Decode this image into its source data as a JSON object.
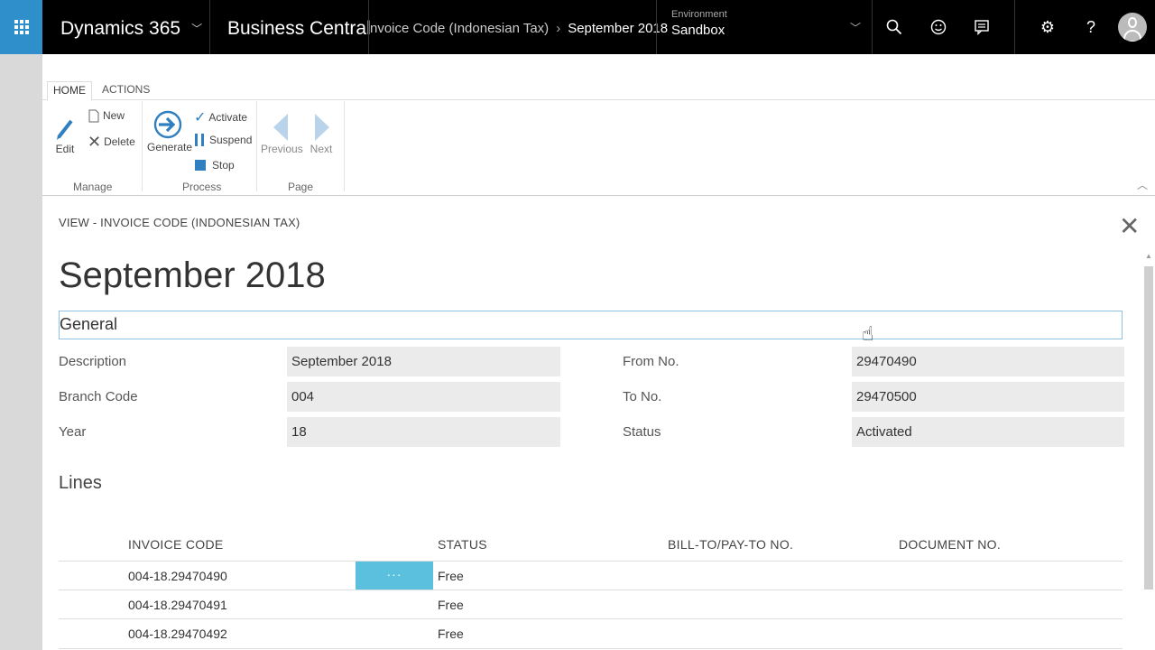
{
  "topbar": {
    "product": "Dynamics 365",
    "app": "Business Central",
    "breadcrumb_parent": "nvoice Code (Indonesian Tax)",
    "breadcrumb_current": "September 2018",
    "env_label": "Environment",
    "env_value": "Sandbox"
  },
  "ribbon": {
    "tabs": [
      "HOME",
      "ACTIONS"
    ],
    "manage": {
      "edit": "Edit",
      "new": "New",
      "delete": "Delete",
      "label": "Manage"
    },
    "process": {
      "generate": "Generate",
      "activate": "Activate",
      "suspend": "Suspend",
      "stop": "Stop",
      "label": "Process"
    },
    "page": {
      "previous": "Previous",
      "next": "Next",
      "label": "Page"
    }
  },
  "page": {
    "view_title": "VIEW - INVOICE CODE (INDONESIAN TAX)",
    "title": "September 2018",
    "general_label": "General",
    "fields_left": [
      {
        "label": "Description",
        "value": "September 2018"
      },
      {
        "label": "Branch Code",
        "value": "004"
      },
      {
        "label": "Year",
        "value": "18"
      }
    ],
    "fields_right": [
      {
        "label": "From No.",
        "value": "29470490"
      },
      {
        "label": "To No.",
        "value": "29470500"
      },
      {
        "label": "Status",
        "value": "Activated"
      }
    ],
    "lines_title": "Lines",
    "columns": [
      "INVOICE CODE",
      "STATUS",
      "BILL-TO/PAY-TO NO.",
      "DOCUMENT NO."
    ],
    "rows": [
      {
        "invoice_code": "004-18.29470490",
        "status": "Free"
      },
      {
        "invoice_code": "004-18.29470491",
        "status": "Free"
      },
      {
        "invoice_code": "004-18.29470492",
        "status": "Free"
      }
    ],
    "row_menu": "···"
  },
  "colors": {
    "accent": "#2f8fcb",
    "menu_cell": "#5bc0de",
    "fasttab_border": "#8fc3e6"
  }
}
